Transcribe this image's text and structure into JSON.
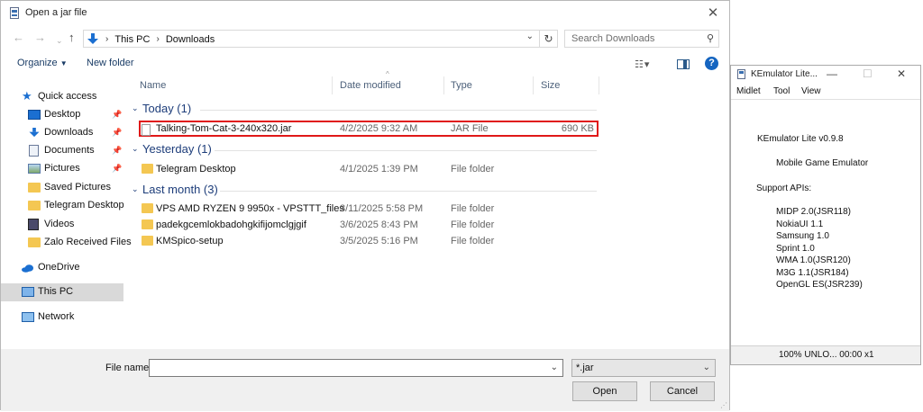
{
  "dialog": {
    "title": "Open a jar file",
    "address": {
      "crumbs": [
        "This PC",
        "Downloads"
      ]
    },
    "search_placeholder": "Search Downloads",
    "toolbar": {
      "organize": "Organize",
      "new_folder": "New folder",
      "help": "?"
    },
    "sidebar": [
      {
        "label": "Quick access",
        "icon": "star-icon"
      },
      {
        "label": "Desktop",
        "icon": "desktop-icon",
        "pinned": true
      },
      {
        "label": "Downloads",
        "icon": "download-arrow-icon",
        "pinned": true
      },
      {
        "label": "Documents",
        "icon": "documents-icon",
        "pinned": true
      },
      {
        "label": "Pictures",
        "icon": "pictures-icon",
        "pinned": true
      },
      {
        "label": "Saved Pictures",
        "icon": "folder-icon"
      },
      {
        "label": "Telegram Desktop",
        "icon": "folder-icon"
      },
      {
        "label": "Videos",
        "icon": "videos-icon"
      },
      {
        "label": "Zalo Received Files",
        "icon": "folder-icon"
      },
      {
        "label": "OneDrive",
        "icon": "cloud-icon"
      },
      {
        "label": "This PC",
        "icon": "computer-icon",
        "selected": true
      },
      {
        "label": "Network",
        "icon": "network-icon"
      }
    ],
    "columns": [
      "Name",
      "Date modified",
      "Type",
      "Size"
    ],
    "groups": [
      {
        "title": "Today (1)",
        "files": [
          {
            "name": "Talking-Tom-Cat-3-240x320.jar",
            "date": "4/2/2025 9:32 AM",
            "type": "JAR File",
            "size": "690 KB",
            "highlighted": true
          }
        ]
      },
      {
        "title": "Yesterday (1)",
        "files": [
          {
            "name": "Telegram Desktop",
            "date": "4/1/2025 1:39 PM",
            "type": "File folder",
            "size": ""
          }
        ]
      },
      {
        "title": "Last month (3)",
        "files": [
          {
            "name": "VPS AMD RYZEN 9 9950x - VPSTTT_files",
            "date": "3/11/2025 5:58 PM",
            "type": "File folder",
            "size": ""
          },
          {
            "name": "padekgcemlokbadohgkifijomclgjgif",
            "date": "3/6/2025 8:43 PM",
            "type": "File folder",
            "size": ""
          },
          {
            "name": "KMSpico-setup",
            "date": "3/5/2025 5:16 PM",
            "type": "File folder",
            "size": ""
          }
        ]
      }
    ],
    "file_name_label": "File name:",
    "file_name_value": "",
    "filter_value": "*.jar",
    "open_label": "Open",
    "cancel_label": "Cancel"
  },
  "kemulator": {
    "title": "KEmulator Lite...",
    "menu": [
      "Midlet",
      "Tool",
      "View"
    ],
    "lines": [
      "KEmulator Lite v0.9.8",
      "Mobile Game Emulator",
      "Support APIs:",
      "MIDP 2.0(JSR118)",
      "NokiaUI 1.1",
      "Samsung 1.0",
      "Sprint 1.0",
      "WMA 1.0(JSR120)",
      "M3G 1.1(JSR184)",
      "OpenGL ES(JSR239)"
    ],
    "status": "100% UNLO... 00:00 x1"
  },
  "colors": {
    "highlight_border": "#e01818",
    "folder": "#f4c752",
    "accent_blue": "#1565c0",
    "group_header": "#1d3d7a"
  }
}
